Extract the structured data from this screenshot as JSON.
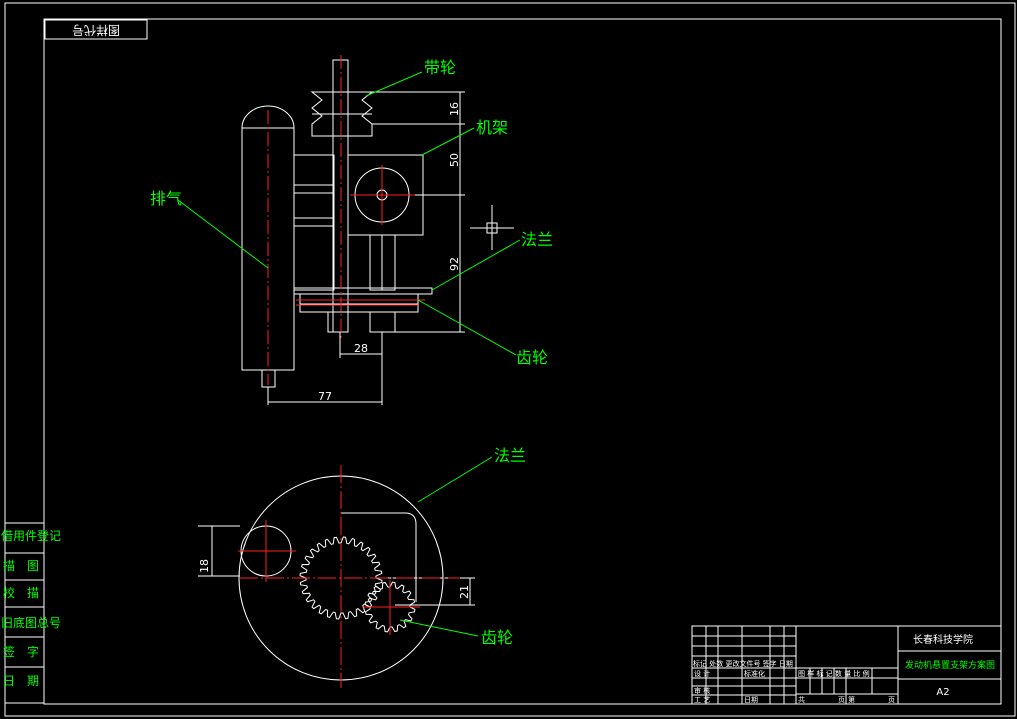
{
  "colors": {
    "background": "#000000",
    "outline": "#ffffff",
    "centerline": "#ff2020",
    "leader": "#00ff00",
    "label_text": "#00ff00",
    "title_text": "#00ff00",
    "block_text": "#ffffff"
  },
  "frame": {
    "corner_tag": "图样代号"
  },
  "labels": {
    "belt_wheel": "带轮",
    "frame": "机架",
    "exhaust": "排气",
    "flange_top": "法兰",
    "gear_top": "齿轮",
    "flange_bottom": "法兰",
    "gear_bottom": "齿轮"
  },
  "dimensions": {
    "d16": "16",
    "d50": "50",
    "d92": "92",
    "d28": "28",
    "d77": "77",
    "d18": "18",
    "d21": "21"
  },
  "side_column": {
    "items": [
      "借用件登记",
      "描　图",
      "校　描",
      "旧底图总号",
      "签　字",
      "日　期"
    ]
  },
  "title_block": {
    "school": "长春科技学院",
    "drawing_title": "发动机悬置支架方案图",
    "sheet_size": "A2",
    "revision_header": "标记 处数 更改文件号 签字 日期",
    "design_label": "设 计",
    "standardize_label": "标准化",
    "review_label": "审 核",
    "process_label": "工 艺",
    "date_label": "日期",
    "stage_header": "图 样 标 记 数 量 比 例",
    "sheet_total": "共",
    "sheet_total_unit": "页",
    "sheet_no": "第",
    "sheet_no_unit": "页"
  }
}
